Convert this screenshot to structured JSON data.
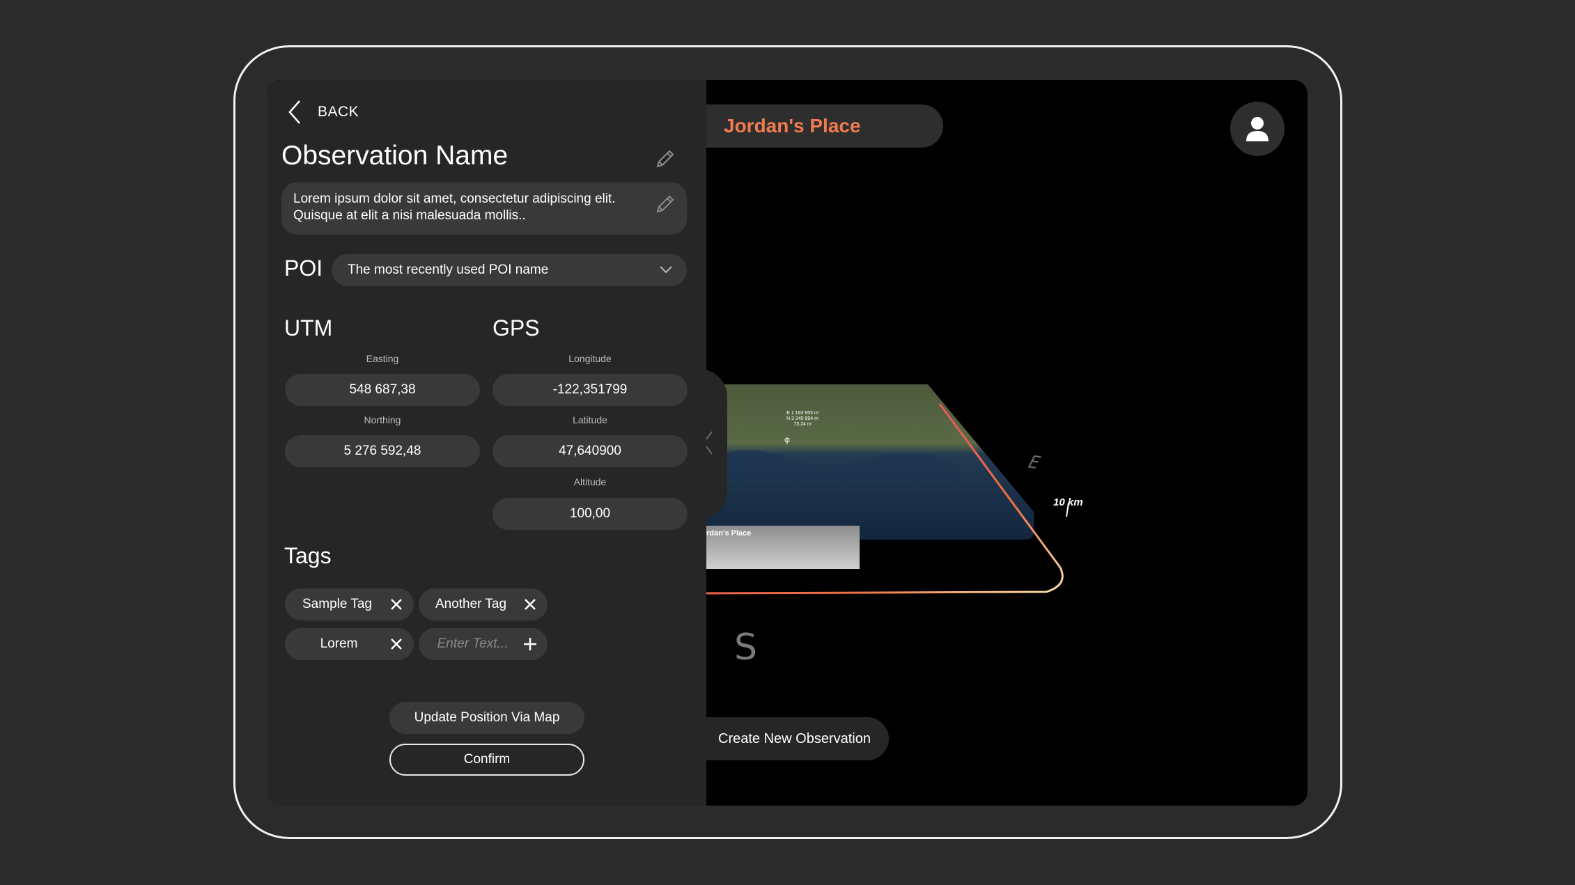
{
  "header": {
    "back_label": "BACK"
  },
  "observation": {
    "title": "Observation Name",
    "description": "Lorem ipsum dolor sit amet, consectetur adipiscing elit. Quisque at elit a nisi malesuada mollis.."
  },
  "poi": {
    "label": "POI",
    "selected": "The most recently used POI name"
  },
  "utm": {
    "heading": "UTM",
    "easting_label": "Easting",
    "easting_value": "548 687,38",
    "northing_label": "Northing",
    "northing_value": "5 276 592,48"
  },
  "gps": {
    "heading": "GPS",
    "longitude_label": "Longitude",
    "longitude_value": "-122,351799",
    "latitude_label": "Latitude",
    "latitude_value": "47,640900",
    "altitude_label": "Altitude",
    "altitude_value": "100,00"
  },
  "tags": {
    "heading": "Tags",
    "items": [
      {
        "label": "Sample Tag"
      },
      {
        "label": "Another Tag"
      },
      {
        "label": "Lorem"
      }
    ],
    "input_placeholder": "Enter Text..."
  },
  "actions": {
    "update_position_label": "Update Position Via Map",
    "confirm_label": "Confirm"
  },
  "map": {
    "place_name": "Jordan's Place",
    "create_label": "Create New Observation",
    "compass_south": "S",
    "compass_east": "E",
    "scale_label": "10 km",
    "marker_label": "rdan's Place",
    "marker_coords": [
      "E 1 183 955 m",
      "N 3 245 694 m",
      "73,24 m"
    ],
    "accent_color": "#ef7b4e"
  }
}
